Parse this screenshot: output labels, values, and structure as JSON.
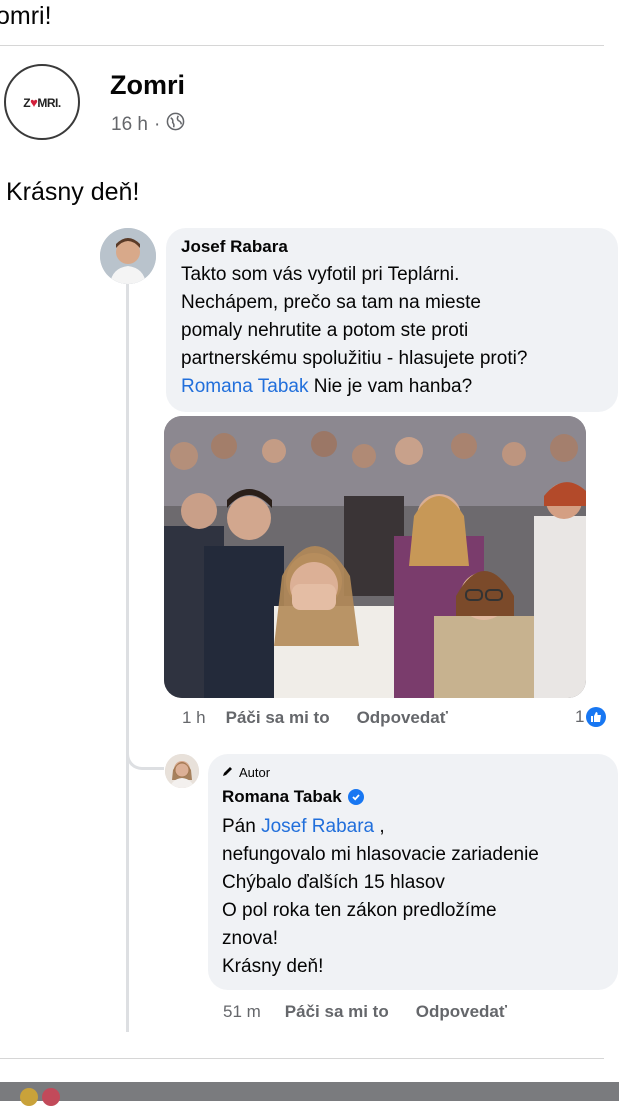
{
  "header": {
    "title_fragment": "omri!"
  },
  "post": {
    "page_name": "Zomri",
    "logo_text_left": "ZO",
    "logo_text_right": "MRI.",
    "time": "16 h",
    "separator": "·",
    "privacy_icon": "globe-icon",
    "text": "Krásny deň!"
  },
  "comments": [
    {
      "author": "Josef Rabara",
      "lines": [
        "Takto som vás vyfotil pri Teplárni.",
        "Nechápem, prečo sa tam na mieste",
        "pomaly nehrutite a potom ste proti",
        "partnerskému spolužitiu - hlasujete proti?"
      ],
      "mention": "Romana Tabak",
      "after_mention": " Nie je vam hanba?",
      "time": "1 h",
      "like_label": "Páči sa mi to",
      "reply_label": "Odpovedať",
      "reaction_count": "1",
      "reaction_icon": "like-icon"
    },
    {
      "badge": "Autor",
      "badge_icon": "pencil-icon",
      "author": "Romana Tabak",
      "verified_icon": "verified-badge-icon",
      "intro": "Pán ",
      "mention": "Josef Rabara",
      "after_mention": " ,",
      "lines": [
        "nefungovalo mi hlasovacie zariadenie",
        "Chýbalo ďalších 15 hlasov",
        "O pol roka ten zákon predložíme",
        "znova!",
        "Krásny deň!"
      ],
      "time": "51 m",
      "like_label": "Páči sa mi to",
      "reply_label": "Odpovedať"
    }
  ],
  "colors": {
    "link": "#216fdb",
    "bubble": "#f0f2f5",
    "secondary_text": "#65676b",
    "logo_heart": "#d3203b"
  }
}
